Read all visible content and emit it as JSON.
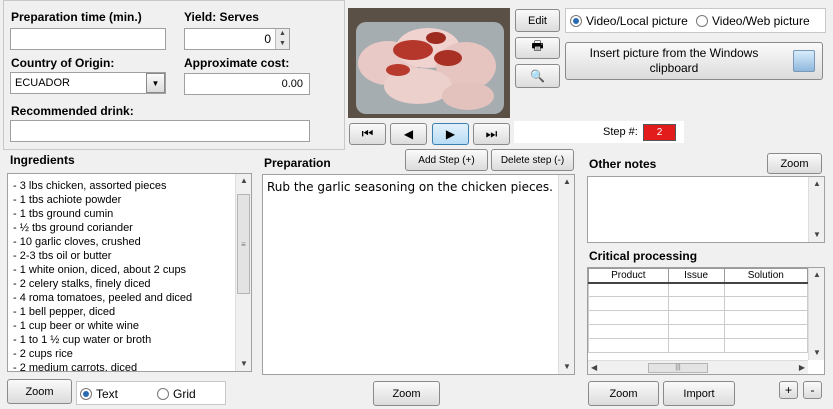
{
  "fields": {
    "prep_time_label": "Preparation time (min.)",
    "prep_time_value": "",
    "yield_label": "Yield: Serves",
    "yield_value": "0",
    "country_label": "Country of Origin:",
    "country_value": "ECUADOR",
    "cost_label": "Approximate cost:",
    "cost_value": "0.00",
    "drink_label": "Recommended drink:",
    "drink_value": ""
  },
  "media": {
    "edit_label": "Edit",
    "radio_local": "Video/Local picture",
    "radio_web": "Video/Web picture",
    "insert_label": "Insert picture from the Windows clipboard",
    "step_label": "Step #:",
    "step_value": "2"
  },
  "ingredients": {
    "title": "Ingredients",
    "items": [
      "- 3 lbs chicken, assorted pieces",
      "- 1 tbs achiote powder",
      "- 1 tbs ground cumin",
      "- ½ tbs ground coriander",
      "- 10 garlic cloves, crushed",
      "- 2-3 tbs oil or butter",
      "- 1 white onion, diced, about 2 cups",
      "- 2 celery stalks, finely diced",
      "- 4 roma tomatoes, peeled and diced",
      "- 1 bell pepper, diced",
      "- 1 cup beer or white wine",
      "- 1 to 1 ½ cup water or broth",
      "- 2 cups rice",
      "- 2 medium carrots. diced"
    ],
    "zoom_label": "Zoom",
    "view_text": "Text",
    "view_grid": "Grid"
  },
  "preparation": {
    "title": "Preparation",
    "add_step": "Add Step (+)",
    "delete_step": "Delete step (-)",
    "text": "Rub the garlic seasoning on the chicken pieces.",
    "zoom_label": "Zoom"
  },
  "notes": {
    "title": "Other notes",
    "zoom_label": "Zoom",
    "text": ""
  },
  "critical": {
    "title": "Critical processing",
    "columns": [
      "Product",
      "Issue",
      "Solution"
    ],
    "zoom_label": "Zoom",
    "import_label": "Import",
    "plus": "+",
    "minus": "-"
  }
}
